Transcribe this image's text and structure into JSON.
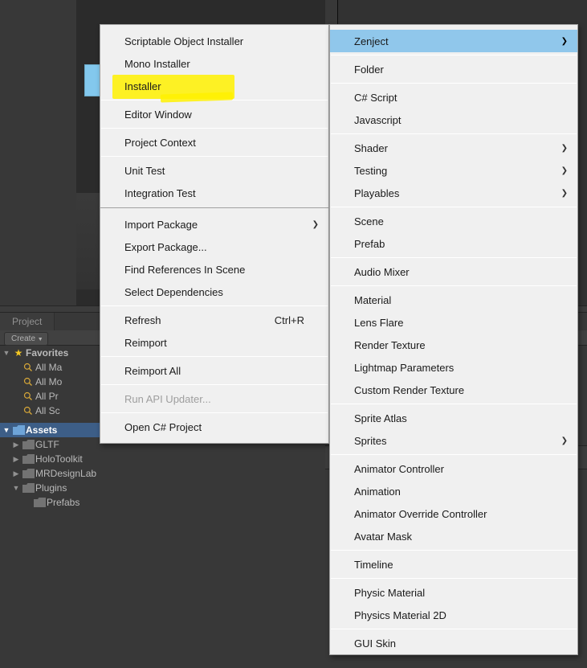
{
  "panel": {
    "project_tab": "Project",
    "create_button": "Create"
  },
  "hierarchy": {
    "favorites": "Favorites",
    "fav_items": [
      "All Ma",
      "All Mo",
      "All Pr",
      "All Sc"
    ],
    "assets": "Assets",
    "folders": [
      "GLTF",
      "HoloToolkit",
      "MRDesignLab",
      "Plugins"
    ],
    "subfolders": [
      "Prefabs"
    ]
  },
  "menu_left": {
    "group1": [
      "Scriptable Object Installer",
      "Mono Installer",
      "Installer"
    ],
    "group2": [
      "Editor Window"
    ],
    "group3": [
      "Project Context"
    ],
    "group4": [
      "Unit Test",
      "Integration Test"
    ],
    "group5": [
      {
        "label": "Import Package",
        "arrow": true
      },
      {
        "label": "Export Package..."
      },
      {
        "label": "Find References In Scene"
      },
      {
        "label": "Select Dependencies"
      }
    ],
    "group6": [
      {
        "label": "Refresh",
        "shortcut": "Ctrl+R"
      },
      {
        "label": "Reimport"
      }
    ],
    "group7": [
      "Reimport All"
    ],
    "group8_disabled": "Run API Updater...",
    "group9": [
      "Open C# Project"
    ]
  },
  "menu_right": {
    "g1": [
      {
        "label": "Zenject",
        "arrow": true,
        "highlight": true
      }
    ],
    "g2": [
      "Folder"
    ],
    "g3": [
      "C# Script",
      "Javascript"
    ],
    "g4": [
      {
        "label": "Shader",
        "arrow": true
      },
      {
        "label": "Testing",
        "arrow": true
      },
      {
        "label": "Playables",
        "arrow": true
      }
    ],
    "g5": [
      "Scene",
      "Prefab"
    ],
    "g6": [
      "Audio Mixer"
    ],
    "g7": [
      "Material",
      "Lens Flare",
      "Render Texture",
      "Lightmap Parameters",
      "Custom Render Texture"
    ],
    "g8": [
      {
        "label": "Sprite Atlas"
      },
      {
        "label": "Sprites",
        "arrow": true
      }
    ],
    "g9": [
      "Animator Controller",
      "Animation",
      "Animator Override Controller",
      "Avatar Mask"
    ],
    "g10": [
      "Timeline"
    ],
    "g11": [
      "Physic Material",
      "Physics Material 2D"
    ],
    "g12": [
      "GUI Skin"
    ]
  }
}
